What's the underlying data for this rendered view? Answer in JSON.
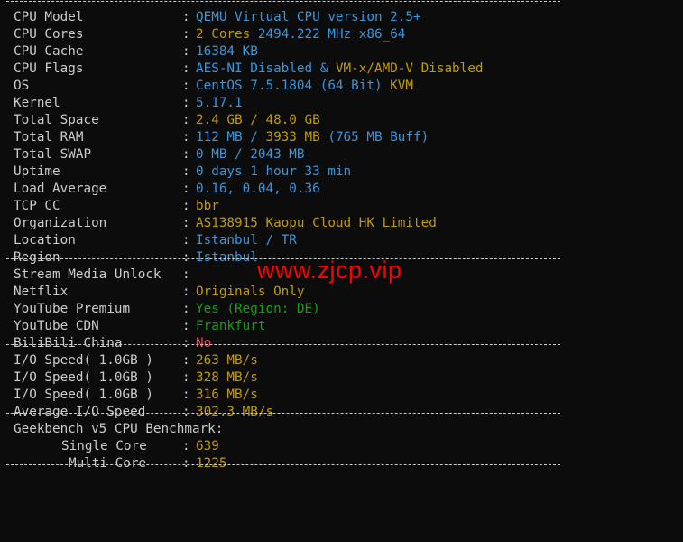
{
  "sys": [
    {
      "label": "CPU Model",
      "parts": [
        {
          "t": "QEMU Virtual CPU version 2.5+",
          "c": "cyan"
        }
      ]
    },
    {
      "label": "CPU Cores",
      "parts": [
        {
          "t": "2 Cores ",
          "c": "yellow"
        },
        {
          "t": "2494.222 MHz x86_64",
          "c": "cyan"
        }
      ]
    },
    {
      "label": "CPU Cache",
      "parts": [
        {
          "t": "16384 KB",
          "c": "cyan"
        }
      ]
    },
    {
      "label": "CPU Flags",
      "parts": [
        {
          "t": "AES-NI Disabled & ",
          "c": "cyan"
        },
        {
          "t": "VM-x/AMD-V Disabled",
          "c": "yellow"
        }
      ]
    },
    {
      "label": "OS",
      "parts": [
        {
          "t": "CentOS 7.5.1804 (64 Bit) ",
          "c": "cyan"
        },
        {
          "t": "KVM",
          "c": "yellow"
        }
      ]
    },
    {
      "label": "Kernel",
      "parts": [
        {
          "t": "5.17.1",
          "c": "cyan"
        }
      ]
    },
    {
      "label": "Total Space",
      "parts": [
        {
          "t": "2.4 GB / ",
          "c": "yellow"
        },
        {
          "t": "48.0 GB",
          "c": "yellow"
        }
      ]
    },
    {
      "label": "Total RAM",
      "parts": [
        {
          "t": "112 MB / ",
          "c": "cyan"
        },
        {
          "t": "3933 MB",
          "c": "yellow"
        },
        {
          "t": " (765 MB Buff)",
          "c": "cyan"
        }
      ]
    },
    {
      "label": "Total SWAP",
      "parts": [
        {
          "t": "0 MB / 2043 MB",
          "c": "cyan"
        }
      ]
    },
    {
      "label": "Uptime",
      "parts": [
        {
          "t": "0 days 1 hour 33 min",
          "c": "cyan"
        }
      ]
    },
    {
      "label": "Load Average",
      "parts": [
        {
          "t": "0.16, 0.04, 0.36",
          "c": "cyan"
        }
      ]
    },
    {
      "label": "TCP CC",
      "parts": [
        {
          "t": "bbr",
          "c": "yellow"
        }
      ]
    },
    {
      "label": "Organization",
      "parts": [
        {
          "t": "AS138915 Kaopu Cloud HK Limited",
          "c": "yellow"
        }
      ]
    },
    {
      "label": "Location",
      "parts": [
        {
          "t": "Istanbul / TR",
          "c": "cyan"
        }
      ]
    },
    {
      "label": "Region",
      "parts": [
        {
          "t": "Istanbul",
          "c": "cyan"
        }
      ]
    }
  ],
  "stream": {
    "header": "Stream Media Unlock",
    "items": [
      {
        "label": "Netflix",
        "parts": [
          {
            "t": "Originals Only",
            "c": "yellow"
          }
        ]
      },
      {
        "label": "YouTube Premium",
        "parts": [
          {
            "t": "Yes (Region: DE)",
            "c": "green"
          }
        ]
      },
      {
        "label": "YouTube CDN",
        "parts": [
          {
            "t": "Frankfurt",
            "c": "green"
          }
        ]
      },
      {
        "label": "BiliBili China",
        "parts": [
          {
            "t": "No",
            "c": "red"
          }
        ]
      }
    ]
  },
  "io": [
    {
      "label": "I/O Speed( 1.0GB )",
      "parts": [
        {
          "t": "263 MB/s",
          "c": "yellow"
        }
      ]
    },
    {
      "label": "I/O Speed( 1.0GB )",
      "parts": [
        {
          "t": "328 MB/s",
          "c": "yellow"
        }
      ]
    },
    {
      "label": "I/O Speed( 1.0GB )",
      "parts": [
        {
          "t": "316 MB/s",
          "c": "yellow"
        }
      ]
    },
    {
      "label": "Average I/O Speed",
      "parts": [
        {
          "t": "302.3 MB/s",
          "c": "yellow"
        }
      ]
    }
  ],
  "geek": {
    "header": "Geekbench v5 CPU Benchmark:",
    "single_label": "Single Core",
    "single_value": "639",
    "multi_label": "Multi Core",
    "multi_value": "1225"
  },
  "colon": ":",
  "watermark": "www.zjcp.vip"
}
